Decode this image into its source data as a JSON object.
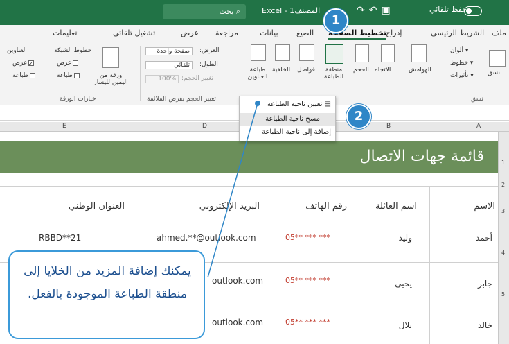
{
  "titlebar": {
    "search_label": "بحث",
    "app_title": "Excel - 1المصنف",
    "autosave_label": "حفظ تلقائي"
  },
  "tabs": {
    "file": "ملف",
    "home": "الشريط الرئيسي",
    "insert": "إدراج",
    "draw": "تخطيط",
    "page_layout": "الصفحة",
    "formulas": "الصيغ",
    "data": "بيانات",
    "review": "مراجعة",
    "view": "عرض",
    "automate": "تشغيل تلقائي",
    "help": "تعليمات"
  },
  "ribbon": {
    "themes": "نسق",
    "colors": "ألوان",
    "fonts": "خطوط",
    "effects": "تأثيرات",
    "margins": "الهوامش",
    "orientation": "الاتجاه",
    "size": "الحجم",
    "print_area": "منطقة الطباعة",
    "breaks": "فواصل",
    "background": "الخلفية",
    "print_titles": "طباعة العناوين",
    "width_label": "العرض:",
    "width_value": "صفحة واحدة",
    "height_label": "الطول:",
    "height_value": "تلقائي",
    "scale_label": "تغيير الحجم:",
    "scale_value": "100%",
    "scale_group": "تغيير الحجم بفرض الملائمة",
    "gridlines": "خطوط الشبكة",
    "headings": "العناوين",
    "view_chk": "عرض",
    "print_chk": "طباعة",
    "sheet_options": "خيارات الورقة",
    "sheet_rtl": "ورقة من اليمين لليسار"
  },
  "menu": {
    "set_print_area": "تعيين ناحية الطباعة",
    "clear_print_area": "مسح ناحية الطباعة",
    "add_to_print_area": "إضافة إلى ناحية الطباعة"
  },
  "columns": [
    "A",
    "B",
    "C",
    "D",
    "E"
  ],
  "rows": [
    "1",
    "2",
    "3",
    "4",
    "5"
  ],
  "sheet": {
    "title": "قائمة جهات الاتصال",
    "headers": [
      "الاسم",
      "اسم العائلة",
      "رقم الهاتف",
      "البريد الإلكتروني",
      "العنوان الوطني"
    ],
    "data": [
      [
        "أحمد",
        "وليد",
        "05** *** ***",
        "ahmed.**@outlook.com",
        "RBBD**21"
      ],
      [
        "جابر",
        "يحيى",
        "05** *** ***",
        "outlook.com",
        ""
      ],
      [
        "خالد",
        "بلال",
        "05** *** ***",
        "outlook.com",
        ""
      ]
    ]
  },
  "callout": {
    "text": "يمكنك إضافة المزيد من الخلايا إلى منطقة الطباعة الموجودة بالفعل."
  },
  "steps": [
    "1",
    "2"
  ]
}
